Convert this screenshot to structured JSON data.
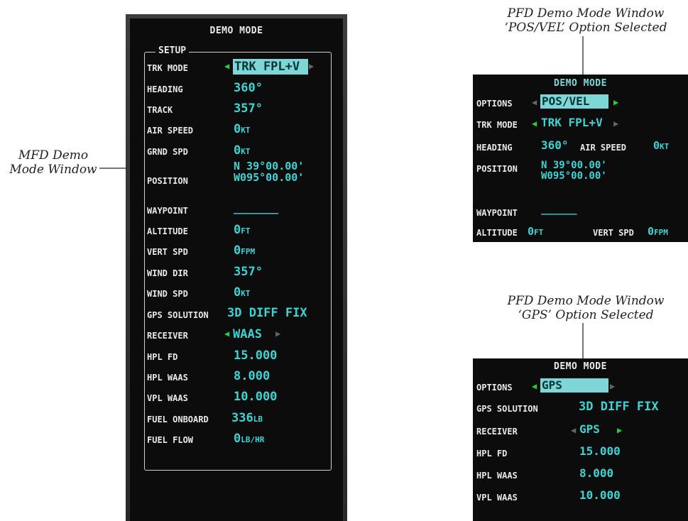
{
  "callouts": {
    "mfd_line1": "MFD Demo",
    "mfd_line2": "Mode Window",
    "pfd1_line1": "PFD Demo Mode Window",
    "pfd1_line2": "‘POS/VEL’ Option Selected",
    "pfd2_line1": "PFD Demo Mode Window",
    "pfd2_line2": "‘GPS’ Option Selected"
  },
  "mfd": {
    "title": "DEMO MODE",
    "setup_label": "SETUP",
    "rows": [
      {
        "label": "TRK MODE",
        "value": "TRK FPL+V"
      },
      {
        "label": "HEADING",
        "value": "360°"
      },
      {
        "label": "TRACK",
        "value": "357°"
      },
      {
        "label": "AIR SPEED",
        "value": "0",
        "unit": "KT"
      },
      {
        "label": "GRND SPD",
        "value": "0",
        "unit": "KT"
      },
      {
        "label": "POSITION",
        "value": "N 39°00.00'",
        "value2": "W095°00.00'"
      },
      {
        "label": "WAYPOINT",
        "value": "_______"
      },
      {
        "label": "ALTITUDE",
        "value": "0",
        "unit": "FT"
      },
      {
        "label": "VERT SPD",
        "value": "0",
        "unit": "FPM"
      },
      {
        "label": "WIND DIR",
        "value": "357°"
      },
      {
        "label": "WIND SPD",
        "value": "0",
        "unit": "KT"
      },
      {
        "label": "GPS SOLUTION",
        "value": "3D DIFF FIX"
      },
      {
        "label": "RECEIVER",
        "value": "WAAS"
      },
      {
        "label": "HPL FD",
        "value": "15.000"
      },
      {
        "label": "HPL WAAS",
        "value": "8.000"
      },
      {
        "label": "VPL WAAS",
        "value": "10.000"
      },
      {
        "label": "FUEL ONBOARD",
        "value": "336",
        "unit": "LB"
      },
      {
        "label": "FUEL FLOW",
        "value": "0",
        "unit": "LB/HR"
      }
    ]
  },
  "pfd_posvel": {
    "title": "DEMO MODE",
    "options_label": "OPTIONS",
    "options_value": "POS/VEL",
    "trk_mode_label": "TRK MODE",
    "trk_mode_value": "TRK FPL+V",
    "heading_label": "HEADING",
    "heading_value": "360°",
    "air_speed_label": "AIR SPEED",
    "air_speed_value": "0",
    "air_speed_unit": "KT",
    "position_label": "POSITION",
    "position_lat": "N 39°00.00'",
    "position_lon": "W095°00.00'",
    "waypoint_label": "WAYPOINT",
    "waypoint_value": "______",
    "altitude_label": "ALTITUDE",
    "altitude_value": "0",
    "altitude_unit": "FT",
    "vert_spd_label": "VERT SPD",
    "vert_spd_value": "0",
    "vert_spd_unit": "FPM"
  },
  "pfd_gps": {
    "title": "DEMO MODE",
    "options_label": "OPTIONS",
    "options_value": "GPS",
    "gps_solution_label": "GPS SOLUTION",
    "gps_solution_value": "3D DIFF FIX",
    "receiver_label": "RECEIVER",
    "receiver_value": "GPS",
    "hpl_fd_label": "HPL FD",
    "hpl_fd_value": "15.000",
    "hpl_waas_label": "HPL WAAS",
    "hpl_waas_value": "8.000",
    "vpl_waas_label": "VPL WAAS",
    "vpl_waas_value": "10.000"
  },
  "colors": {
    "value": "#3fd4d4",
    "arrow_active": "#1fd43a",
    "arrow_inactive": "#666666",
    "background": "#0c0c0c"
  }
}
